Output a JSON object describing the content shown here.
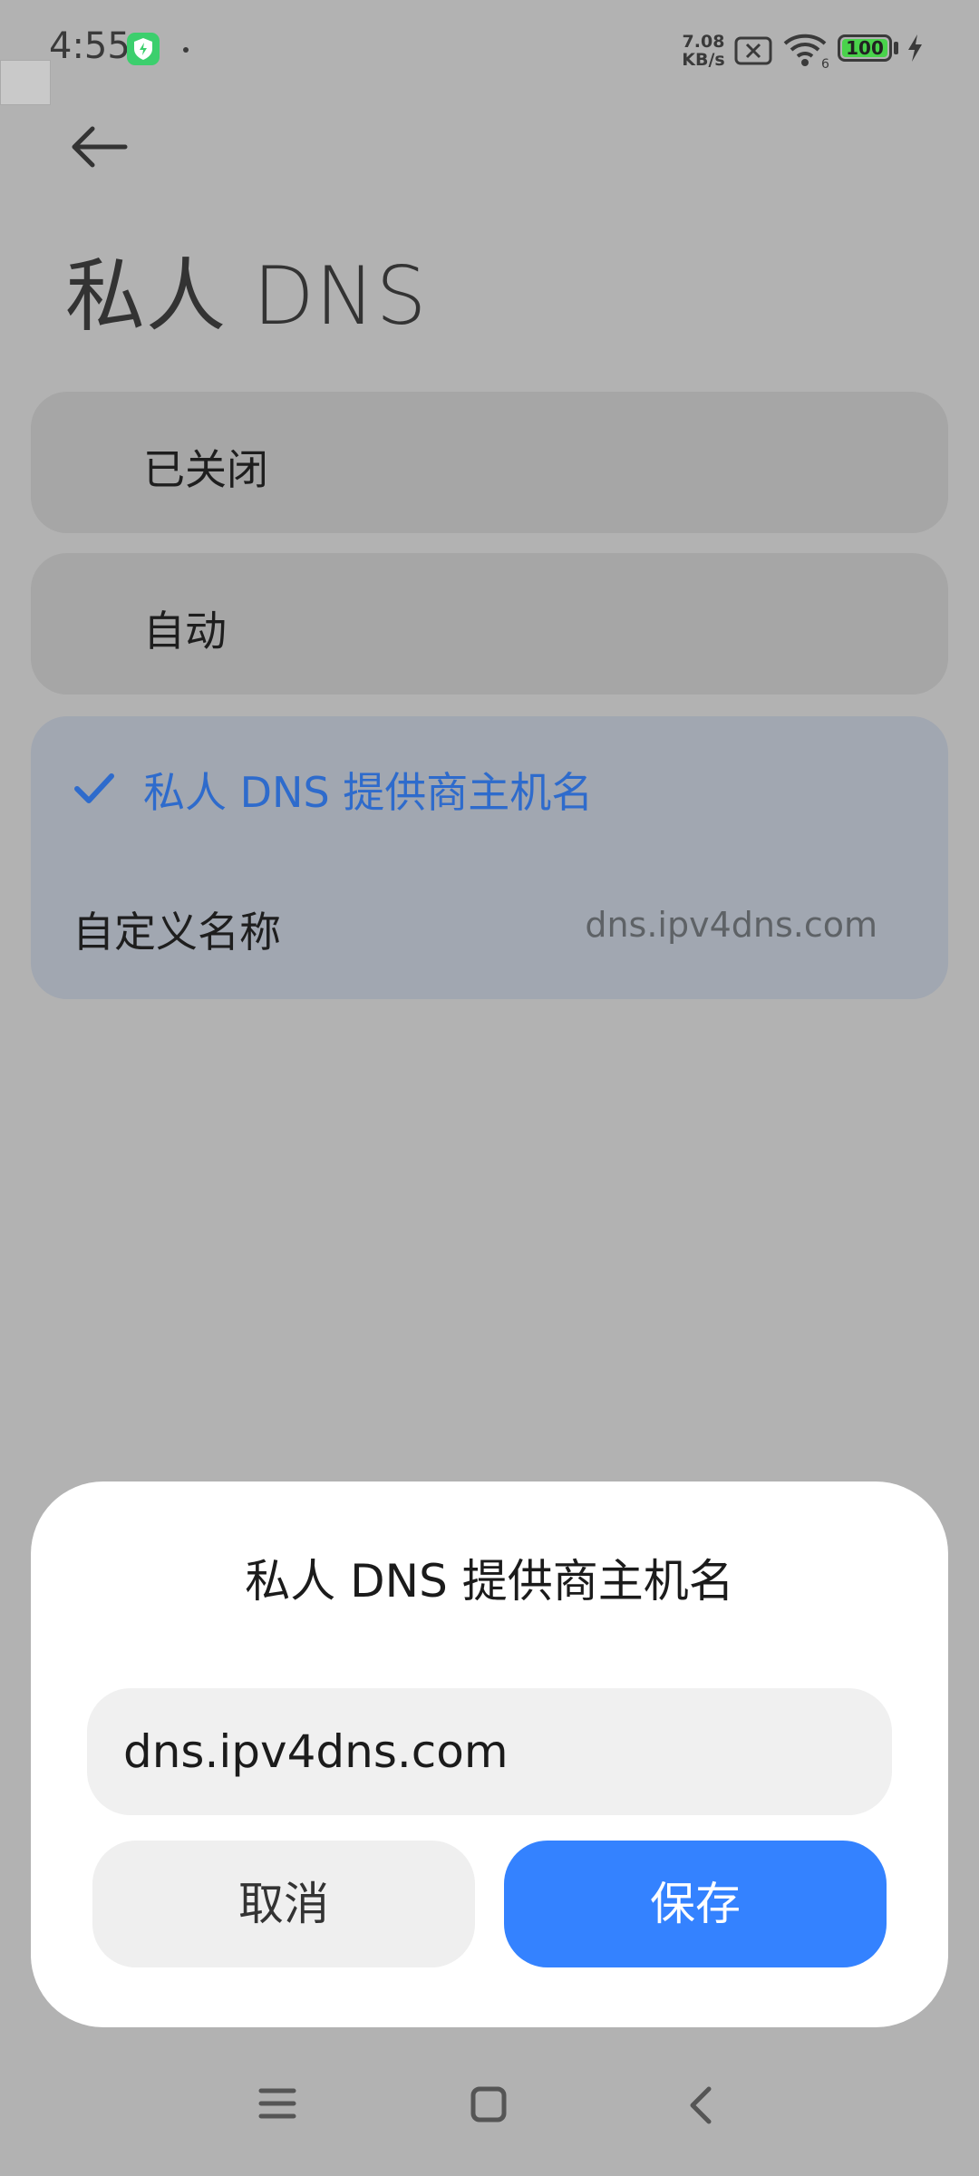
{
  "status_bar": {
    "time": "4:55",
    "net_speed_value": "7.08",
    "net_speed_unit": "KB/s",
    "wifi_badge": "6",
    "battery": "100"
  },
  "header": {
    "title": "私人 DNS"
  },
  "options": {
    "off_label": "已关闭",
    "auto_label": "自动",
    "provider_label": "私人 DNS 提供商主机名",
    "custom_name_label": "自定义名称",
    "custom_name_value": "dns.ipv4dns.com"
  },
  "dialog": {
    "title": "私人 DNS 提供商主机名",
    "input_value": "dns.ipv4dns.com",
    "cancel_label": "取消",
    "save_label": "保存"
  },
  "colors": {
    "accent": "#3482ff",
    "selected_text": "#2e6bcc",
    "scrim": "#b2b2b2"
  }
}
